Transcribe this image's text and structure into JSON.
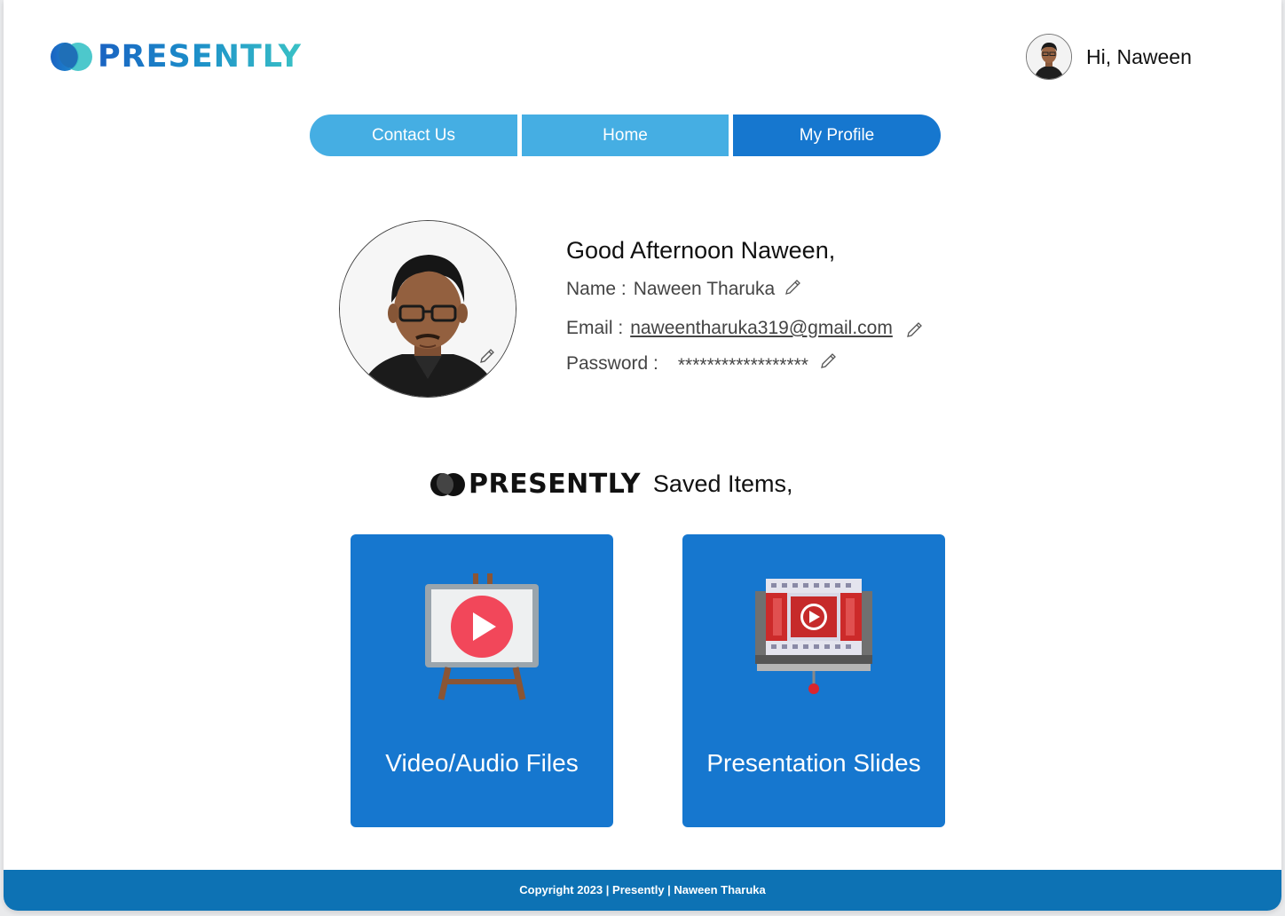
{
  "header": {
    "logo_text": "PRESENTLY",
    "greeting": "Hi, Naween"
  },
  "nav": {
    "items": [
      {
        "label": "Contact Us"
      },
      {
        "label": "Home"
      },
      {
        "label": "My Profile",
        "active": true
      }
    ]
  },
  "profile": {
    "greeting": "Good Afternoon Naween,",
    "name_label": "Name :",
    "name_value": "Naween Tharuka",
    "email_label": "Email :",
    "email_value": "naweentharuka319@gmail.com",
    "password_label": "Password :",
    "password_value": "******************"
  },
  "saved": {
    "logo_text": "PRESENTLY",
    "title": "Saved Items,",
    "cards": [
      {
        "label": "Video/Audio Files",
        "icon": "easel-video-icon"
      },
      {
        "label": "Presentation Slides",
        "icon": "projector-film-icon"
      }
    ]
  },
  "footer": {
    "text": "Copyright 2023 | Presently | Naween Tharuka"
  },
  "colors": {
    "primary_blue": "#1677cf",
    "nav_light_blue": "#45aee3",
    "footer_blue": "#0d72b4"
  }
}
